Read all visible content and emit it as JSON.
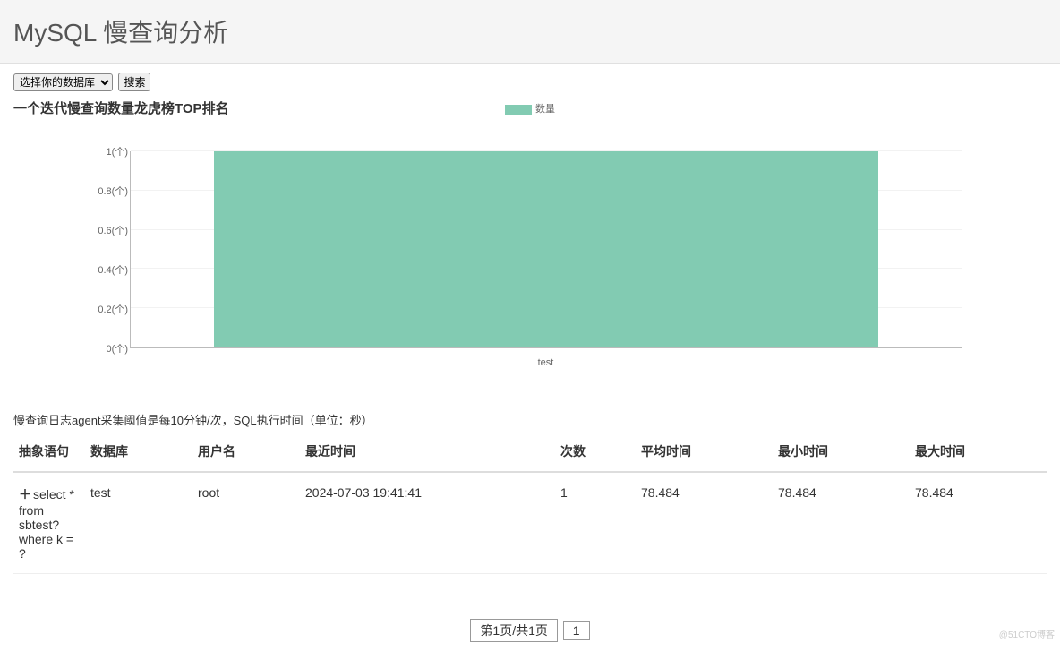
{
  "header": {
    "title": "MySQL 慢查询分析"
  },
  "controls": {
    "db_select_placeholder": "选择你的数据库",
    "search_label": "搜索"
  },
  "chart_section_title": "一个迭代慢查询数量龙虎榜TOP排名",
  "legend_label": "数量",
  "chart_data": {
    "type": "bar",
    "categories": [
      "test"
    ],
    "values": [
      1
    ],
    "title": "一个迭代慢查询数量龙虎榜TOP排名",
    "xlabel": "",
    "ylabel": "数量(个)",
    "ylim": [
      0,
      1
    ],
    "y_ticks": [
      "0(个)",
      "0.2(个)",
      "0.4(个)",
      "0.6(个)",
      "0.8(个)",
      "1(个)"
    ]
  },
  "note": "慢查询日志agent采集阈值是每10分钟/次，SQL执行时间（单位：秒）",
  "table": {
    "columns": {
      "sql": "抽象语句",
      "db": "数据库",
      "user": "用户名",
      "recent": "最近时间",
      "count": "次数",
      "avg": "平均时间",
      "min": "最小时间",
      "max": "最大时间"
    },
    "rows": [
      {
        "sql": "select * from sbtest? where k = ?",
        "db": "test",
        "user": "root",
        "recent": "2024-07-03 19:41:41",
        "count": "1",
        "avg": "78.484",
        "min": "78.484",
        "max": "78.484"
      }
    ]
  },
  "pager": {
    "info": "第1页/共1页",
    "current": "1"
  },
  "watermark": "@51CTO博客"
}
